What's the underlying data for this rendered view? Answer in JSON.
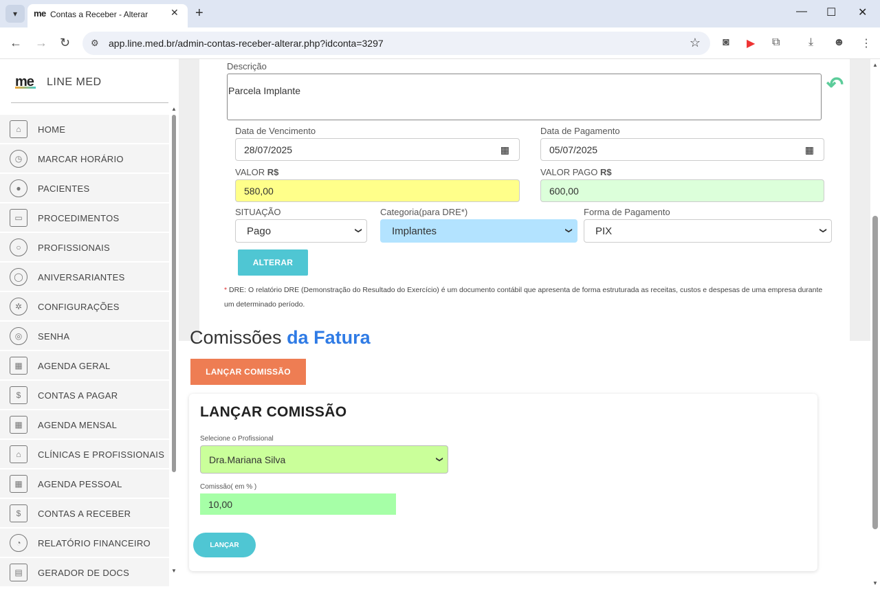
{
  "browser": {
    "tab_title": "Contas a Receber - Alterar",
    "tab_favicon": "me",
    "url": "app.line.med.br/admin-contas-receber-alterar.php?idconta=3297"
  },
  "sidebar": {
    "logo": "me",
    "brand": "LINE MED",
    "items": [
      {
        "label": "HOME",
        "icon": "bank-icon"
      },
      {
        "label": "MARCAR HORÁRIO",
        "icon": "alarm-clock-icon"
      },
      {
        "label": "PACIENTES",
        "icon": "user-icon"
      },
      {
        "label": "PROCEDIMENTOS",
        "icon": "box-icon"
      },
      {
        "label": "PROFISSIONAIS",
        "icon": "user-circle-icon"
      },
      {
        "label": "ANIVERSARIANTES",
        "icon": "balloon-icon"
      },
      {
        "label": "CONFIGURAÇÕES",
        "icon": "gear-icon"
      },
      {
        "label": "SENHA",
        "icon": "fingerprint-icon"
      },
      {
        "label": "AGENDA GERAL",
        "icon": "calendar-icon"
      },
      {
        "label": "CONTAS A PAGAR",
        "icon": "bills-icon"
      },
      {
        "label": "AGENDA MENSAL",
        "icon": "calendar-icon"
      },
      {
        "label": "CLÍNICAS E PROFISSIONAIS",
        "icon": "bank-icon"
      },
      {
        "label": "AGENDA PESSOAL",
        "icon": "calendar-icon"
      },
      {
        "label": "CONTAS A RECEBER",
        "icon": "bills-icon"
      },
      {
        "label": "RELATÓRIO FINANCEIRO",
        "icon": "pie-chart-icon"
      },
      {
        "label": "GERADOR DE DOCS",
        "icon": "id-card-icon"
      }
    ]
  },
  "form": {
    "descricao_label": "Descrição",
    "descricao_value": "Parcela Implante",
    "vencimento_label": "Data de Vencimento",
    "vencimento_value": "28/07/2025",
    "pagamento_label": "Data de Pagamento",
    "pagamento_value": "05/07/2025",
    "valor_label": "VALOR",
    "valor_currency": "R$",
    "valor_value": "580,00",
    "valor_pago_label": "VALOR PAGO",
    "valor_pago_currency": "R$",
    "valor_pago_value": "600,00",
    "situacao_label": "SITUAÇÃO",
    "situacao_value": "Pago",
    "categoria_label": "Categoria(para DRE*)",
    "categoria_value": "Implantes",
    "forma_label": "Forma de Pagamento",
    "forma_value": "PIX",
    "alterar_button": "ALTERAR",
    "note_star": "*",
    "note": "DRE: O relatório DRE (Demonstração do Resultado do Exercício) é um documento contábil que apresenta de forma estruturada as receitas, custos e despesas de uma empresa durante um determinado período."
  },
  "comissoes": {
    "title_plain": "Comissões",
    "title_highlight": "da Fatura",
    "lancar_comissao_button": "LANÇAR COMISSÃO",
    "form_title": "LANÇAR COMISSÃO",
    "profissional_label": "Selecione o Profissional",
    "profissional_value": "Dra.Mariana Silva",
    "comissao_label": "Comissão( em % )",
    "comissao_value": "10,00",
    "lancar_button": "LANÇAR"
  },
  "colors": {
    "valor_bg": "#ffff8a",
    "valor_pago_bg": "#dcffda",
    "categoria_bg": "#b3e3ff",
    "accent_teal": "#4fc6d3",
    "accent_orange": "#ee7d53",
    "title_blue": "#2f7be5"
  }
}
